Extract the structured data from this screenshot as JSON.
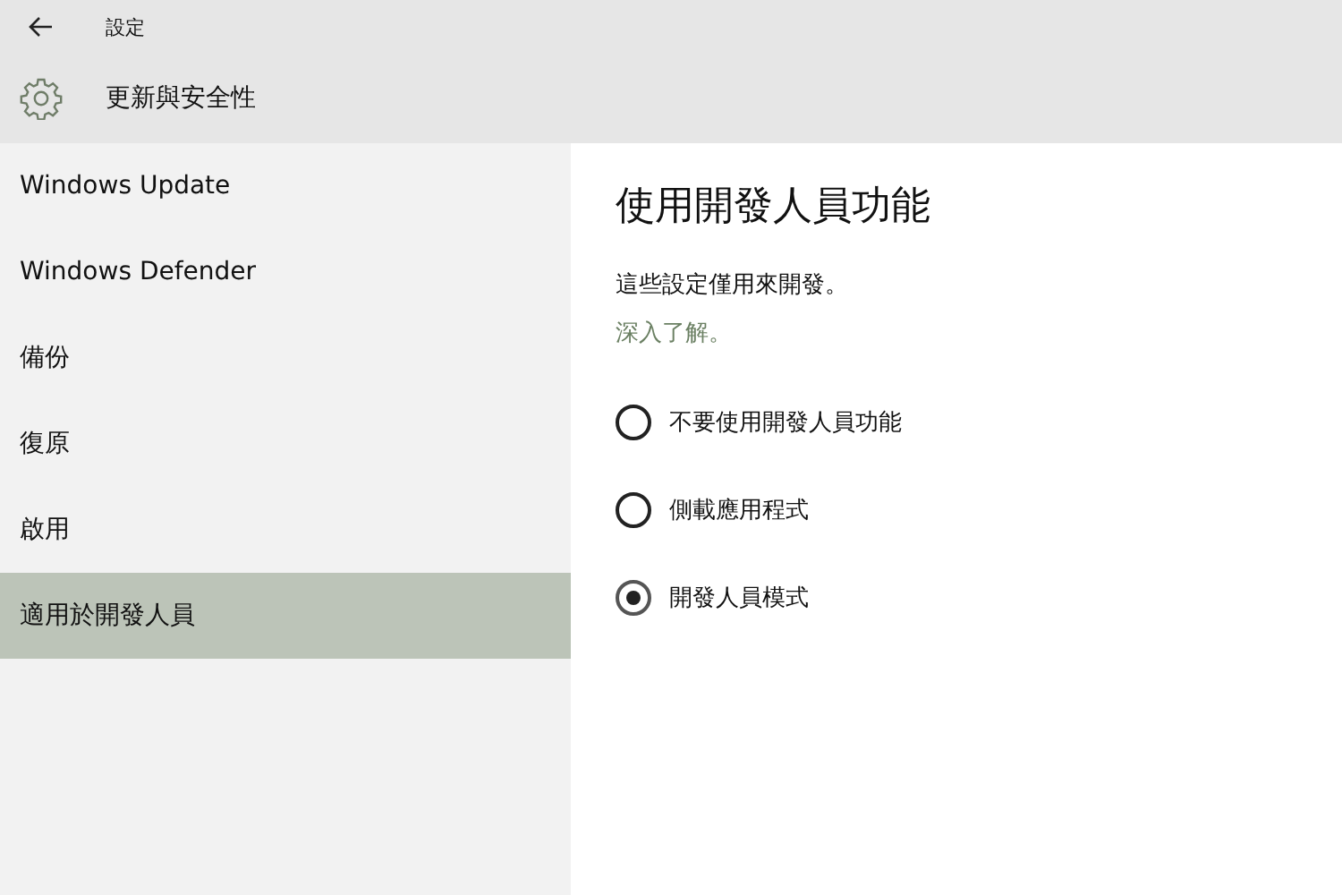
{
  "window": {
    "title": "設定"
  },
  "header": {
    "title": "更新與安全性"
  },
  "sidebar": {
    "items": [
      {
        "label": "Windows Update",
        "selected": false
      },
      {
        "label": "Windows Defender",
        "selected": false
      },
      {
        "label": "備份",
        "selected": false
      },
      {
        "label": "復原",
        "selected": false
      },
      {
        "label": "啟用",
        "selected": false
      },
      {
        "label": "適用於開發人員",
        "selected": true
      }
    ]
  },
  "content": {
    "heading": "使用開發人員功能",
    "description": "這些設定僅用來開發。",
    "link": "深入了解。",
    "options": [
      {
        "label": "不要使用開發人員功能",
        "selected": false
      },
      {
        "label": "側載應用程式",
        "selected": false
      },
      {
        "label": "開發人員模式",
        "selected": true
      }
    ]
  }
}
